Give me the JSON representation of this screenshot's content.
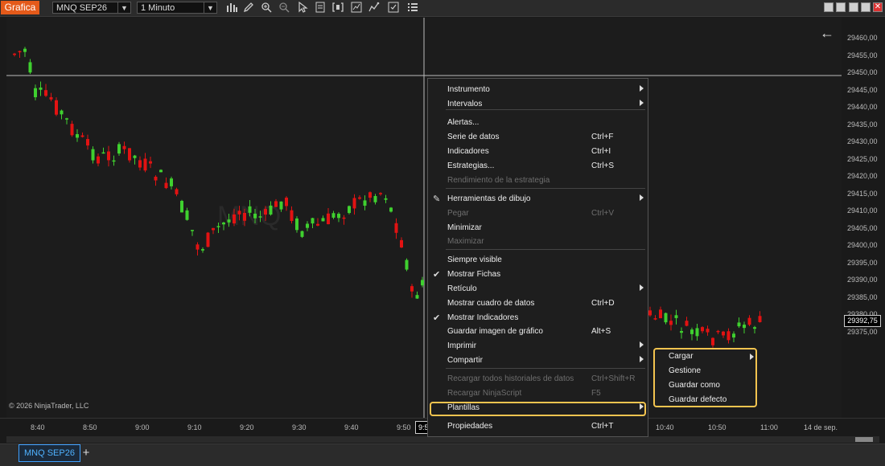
{
  "toolbar": {
    "app_label": "Grafica",
    "instrument": "MNQ SEP26",
    "interval": "1 Minuto",
    "tools": [
      "bar-chart-icon",
      "pencil-icon",
      "zoom-in-icon",
      "zoom-out-icon",
      "cursor-icon",
      "data-box-icon",
      "bracket-icon",
      "chart-trader-icon",
      "strategy-icon",
      "template-icon",
      "properties-icon"
    ]
  },
  "chart": {
    "watermark": "MNQ",
    "copyright": "© 2026 NinjaTrader, LLC",
    "current_price": "29392,75",
    "cursor_time": "9:5",
    "price_labels": [
      "29460,00",
      "29455,00",
      "29450,00",
      "29445,00",
      "29440,00",
      "29435,00",
      "29430,00",
      "29425,00",
      "29420,00",
      "29415,00",
      "29410,00",
      "29405,00",
      "29400,00",
      "29395,00",
      "29390,00",
      "29385,00",
      "29380,00",
      "29375,00"
    ],
    "time_labels": [
      "8:40",
      "8:50",
      "9:00",
      "9:10",
      "9:20",
      "9:30",
      "9:40",
      "9:50",
      "10:40",
      "10:50",
      "11:00",
      "14 de sep."
    ],
    "colors": {
      "up": "#3fd02f",
      "down": "#e21212"
    }
  },
  "menu": {
    "items": [
      {
        "label": "Instrumento",
        "shortcut": "",
        "submenu": true,
        "disabled": false,
        "check": false
      },
      {
        "label": "Intervalos",
        "shortcut": "",
        "submenu": true,
        "disabled": false,
        "check": false
      },
      {
        "label": "Alertas...",
        "shortcut": "",
        "submenu": false,
        "disabled": false,
        "check": false
      },
      {
        "label": "Serie de datos",
        "shortcut": "Ctrl+F",
        "submenu": false,
        "disabled": false,
        "check": false
      },
      {
        "label": "Indicadores",
        "shortcut": "Ctrl+I",
        "submenu": false,
        "disabled": false,
        "check": false
      },
      {
        "label": "Estrategias...",
        "shortcut": "Ctrl+S",
        "submenu": false,
        "disabled": false,
        "check": false
      },
      {
        "label": "Rendimiento de la estrategia",
        "shortcut": "",
        "submenu": false,
        "disabled": true,
        "check": false
      },
      {
        "label": "Herramientas de dibujo",
        "shortcut": "",
        "submenu": true,
        "disabled": false,
        "check": false
      },
      {
        "label": "Pegar",
        "shortcut": "Ctrl+V",
        "submenu": false,
        "disabled": true,
        "check": false
      },
      {
        "label": "Minimizar",
        "shortcut": "",
        "submenu": false,
        "disabled": false,
        "check": false
      },
      {
        "label": "Maximizar",
        "shortcut": "",
        "submenu": false,
        "disabled": true,
        "check": false
      },
      {
        "label": "Siempre visible",
        "shortcut": "",
        "submenu": false,
        "disabled": false,
        "check": false
      },
      {
        "label": "Mostrar Fichas",
        "shortcut": "",
        "submenu": false,
        "disabled": false,
        "check": true
      },
      {
        "label": "Retículo",
        "shortcut": "",
        "submenu": true,
        "disabled": false,
        "check": false
      },
      {
        "label": "Mostrar cuadro de datos",
        "shortcut": "Ctrl+D",
        "submenu": false,
        "disabled": false,
        "check": false
      },
      {
        "label": "Mostrar Indicadores",
        "shortcut": "",
        "submenu": false,
        "disabled": false,
        "check": true
      },
      {
        "label": "Guardar imagen de gráfico",
        "shortcut": "Alt+S",
        "submenu": false,
        "disabled": false,
        "check": false
      },
      {
        "label": "Imprimir",
        "shortcut": "",
        "submenu": true,
        "disabled": false,
        "check": false
      },
      {
        "label": "Compartir",
        "shortcut": "",
        "submenu": true,
        "disabled": false,
        "check": false
      },
      {
        "label": "Recargar todos historiales de datos",
        "shortcut": "Ctrl+Shift+R",
        "submenu": false,
        "disabled": true,
        "check": false
      },
      {
        "label": "Recargar NinjaScript",
        "shortcut": "F5",
        "submenu": false,
        "disabled": true,
        "check": false
      },
      {
        "label": "Plantillas",
        "shortcut": "",
        "submenu": true,
        "disabled": false,
        "check": false
      },
      {
        "label": "Propiedades",
        "shortcut": "Ctrl+T",
        "submenu": false,
        "disabled": false,
        "check": false
      }
    ]
  },
  "submenu": {
    "items": [
      {
        "label": "Cargar",
        "submenu": true
      },
      {
        "label": "Gestione",
        "submenu": false
      },
      {
        "label": "Guardar como",
        "submenu": false
      },
      {
        "label": "Guardar defecto",
        "submenu": false
      }
    ]
  },
  "bottom": {
    "tab_label": "MNQ SEP26",
    "add_label": "+"
  }
}
